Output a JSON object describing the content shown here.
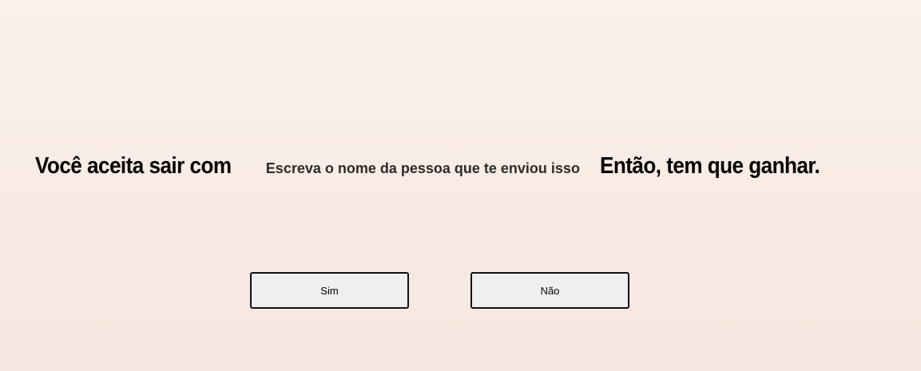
{
  "question": {
    "before": "Você aceita sair com",
    "input_placeholder": "Escreva o nome da pessoa que te enviou isso",
    "input_value": "",
    "after": "Então, tem que ganhar."
  },
  "buttons": {
    "yes_label": "Sim",
    "no_label": "Não"
  },
  "colors": {
    "background_top": "#faf1ec",
    "background_bottom": "#f6e6df",
    "button_fill": "#efefef",
    "button_border": "#111111"
  }
}
